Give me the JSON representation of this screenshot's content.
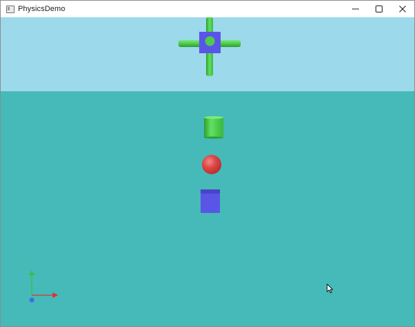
{
  "window": {
    "title": "PhysicsDemo",
    "minimize_icon": "minimize-icon",
    "maximize_icon": "maximize-icon",
    "close_icon": "close-icon"
  },
  "scene": {
    "sky_color": "#9cd9ea",
    "floor_color": "#45bab8",
    "objects": [
      {
        "name": "cross-structure",
        "colors": [
          "#5a55e6",
          "#4ecb4e"
        ]
      },
      {
        "name": "green-cylinder",
        "color": "#4ecb4e"
      },
      {
        "name": "red-sphere",
        "color": "#e04848"
      },
      {
        "name": "blue-cube",
        "color": "#5a55e6"
      }
    ],
    "axes_gizmo": {
      "x_color": "#e03030",
      "y_color": "#3bbf3b",
      "z_color": "#3a6fe0"
    }
  }
}
